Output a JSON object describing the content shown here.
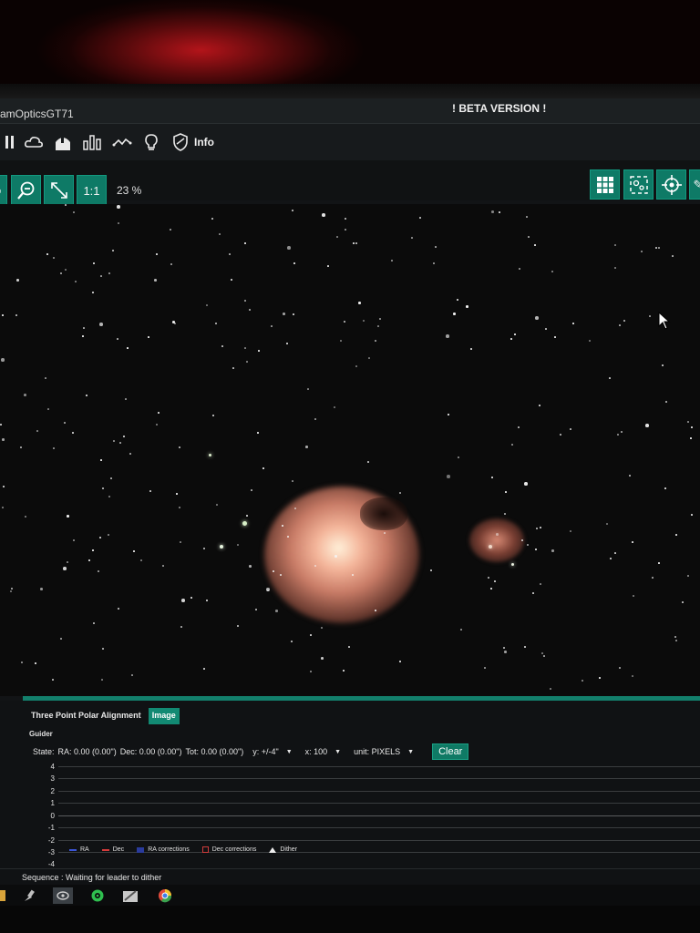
{
  "window": {
    "title": "amOpticsGT71",
    "beta_banner": "! BETA VERSION !"
  },
  "navbar": {
    "icons": [
      "equipment-icon",
      "weather-icon",
      "observatory-icon",
      "stats-icon",
      "curve-icon",
      "bulb-icon",
      "shield-icon"
    ],
    "info_label": "Info"
  },
  "toolbar": {
    "zoom_in_icon": "zoom-in-icon",
    "zoom_out_icon": "zoom-out-icon",
    "fit_icon": "fit-icon",
    "one_to_one_label": "1:1",
    "zoom_level": "23 %",
    "right_icons": [
      "grid-icon",
      "star-detection-icon",
      "crosshair-icon",
      "tool-icon"
    ]
  },
  "panel": {
    "tabs": [
      {
        "label": "Three Point Polar Alignment",
        "active": false
      },
      {
        "label": "Image",
        "active": true
      }
    ],
    "guider_label": "Guider",
    "state_label": "State:",
    "ra": "RA: 0.00 (0.00\")",
    "dec": "Dec: 0.00 (0.00\")",
    "tot": "Tot: 0.00 (0.00\")",
    "y_scale": "y: +/-4\"",
    "x_scale": "x: 100",
    "unit": "unit: PIXELS",
    "clear_label": "Clear",
    "y_axis": [
      "4",
      "3",
      "2",
      "1",
      "0",
      "-1",
      "-2",
      "-3",
      "-4"
    ],
    "legend": [
      {
        "label": "RA",
        "color": "#3b55d6"
      },
      {
        "label": "Dec",
        "color": "#d63b3b"
      },
      {
        "label": "RA corrections",
        "color": "#2a3b9c"
      },
      {
        "label": "Dec corrections",
        "color": "#d03b3b"
      },
      {
        "label": "Dither",
        "color": "#eeeeee"
      }
    ]
  },
  "status": {
    "sequence": "Sequence :   Waiting for leader to dither"
  },
  "colors": {
    "accent": "#0e7a66",
    "background": "#121416"
  }
}
